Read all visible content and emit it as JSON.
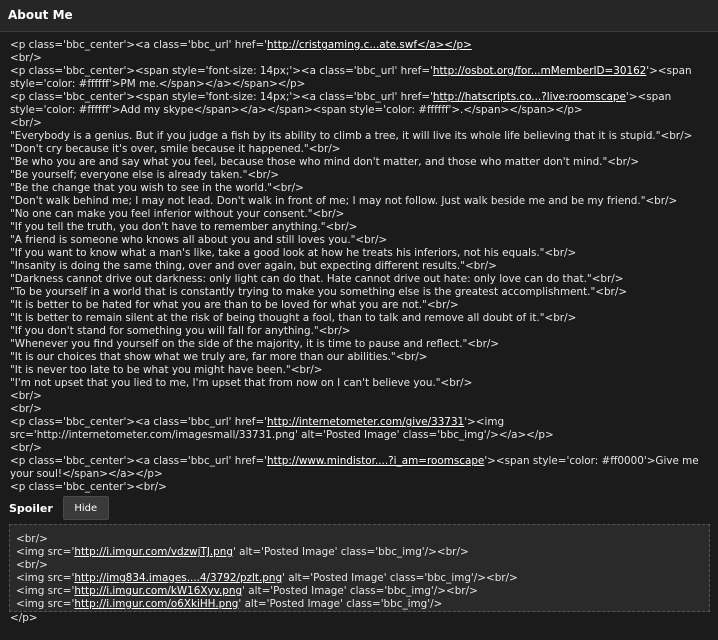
{
  "header": {
    "title": "About Me"
  },
  "lines": [
    [
      {
        "t": "<p class='bbc_center'><a class='bbc_url' href='"
      },
      {
        "t": "http://cristgaming.c...ate.swf</a></p>",
        "l": 1
      }
    ],
    [
      {
        "t": "<br/>"
      }
    ],
    [
      {
        "t": "<p class='bbc_center'><span style='font-size: 14px;'><a class='bbc_url' href='"
      },
      {
        "t": "http://osbot.org/for...mMemberID=30162",
        "l": 1
      },
      {
        "t": "'><span style='color: #ffffff'>PM me.</span></a></span></p>"
      }
    ],
    [
      {
        "t": "<p class='bbc_center'><span style='font-size: 14px;'><a class='bbc_url' href='"
      },
      {
        "t": "http://hatscripts.co...?live:roomscape",
        "l": 1
      },
      {
        "t": "'><span style='color: #ffffff'>Add my skype</span></a></span><span style='color: #ffffff'>.</span></span></p>"
      }
    ],
    [
      {
        "t": "<br/>"
      }
    ],
    [
      {
        "t": "\"Everybody is a genius. But if you judge a fish by its ability to climb a tree, it will live its whole life believing that it is stupid.\"<br/>"
      }
    ],
    [
      {
        "t": "\"Don't cry because it's over, smile because it happened.\"<br/>"
      }
    ],
    [
      {
        "t": "\"Be who you are and say what you feel, because those who mind don't matter, and those who matter don't mind.\"<br/>"
      }
    ],
    [
      {
        "t": "\"Be yourself; everyone else is already taken.\"<br/>"
      }
    ],
    [
      {
        "t": "\"Be the change that you wish to see in the world.\"<br/>"
      }
    ],
    [
      {
        "t": "\"Don't walk behind me; I may not lead. Don't walk in front of me; I may not follow. Just walk beside me and be my friend.\"<br/>"
      }
    ],
    [
      {
        "t": "\"No one can make you feel inferior without your consent.\"<br/>"
      }
    ],
    [
      {
        "t": "\"If you tell the truth, you don't have to remember anything.\"<br/>"
      }
    ],
    [
      {
        "t": "\"A friend is someone who knows all about you and still loves you.\"<br/>"
      }
    ],
    [
      {
        "t": "\"If you want to know what a man's like, take a good look at how he treats his inferiors, not his equals.\"<br/>"
      }
    ],
    [
      {
        "t": "\"Insanity is doing the same thing, over and over again, but expecting different results.\"<br/>"
      }
    ],
    [
      {
        "t": "\"Darkness cannot drive out darkness: only light can do that. Hate cannot drive out hate: only love can do that.\"<br/>"
      }
    ],
    [
      {
        "t": "\"To be yourself in a world that is constantly trying to make you something else is the greatest accomplishment.\"<br/>"
      }
    ],
    [
      {
        "t": "\"It is better to be hated for what you are than to be loved for what you are not.\"<br/>"
      }
    ],
    [
      {
        "t": "\"It is better to remain silent at the risk of being thought a fool, than to talk and remove all doubt of it.\"<br/>"
      }
    ],
    [
      {
        "t": "\"If you don't stand for something you will fall for anything.\"<br/>"
      }
    ],
    [
      {
        "t": "\"Whenever you find yourself on the side of the majority, it is time to pause and reflect.\"<br/>"
      }
    ],
    [
      {
        "t": "\"It is our choices that show what we truly are, far more than our abilities.\"<br/>"
      }
    ],
    [
      {
        "t": "\"It is never too late to be what you might have been.\"<br/>"
      }
    ],
    [
      {
        "t": "\"I'm not upset that you lied to me, I'm upset that from now on I can't believe you.\"<br/>"
      }
    ],
    [
      {
        "t": "<br/>"
      }
    ],
    [
      {
        "t": "<br/>"
      }
    ],
    [
      {
        "t": "<p class='bbc_center'><a class='bbc_url' href='"
      },
      {
        "t": "http://internetometer.com/give/33731",
        "l": 1
      },
      {
        "t": "'><img src='http://internetometer.com/imagesmall/33731.png' alt='Posted Image' class='bbc_img'/></a></p>"
      }
    ],
    [
      {
        "t": "<br/>"
      }
    ],
    [
      {
        "t": "<p class='bbc_center'><a class='bbc_url' href='"
      },
      {
        "t": "http://www.mindistor....?i_am=roomscape",
        "l": 1
      },
      {
        "t": "'><span style='color: #ff0000'>Give me your soul!</span></a></p>"
      }
    ],
    [
      {
        "t": "<p class='bbc_center'><br/>"
      }
    ]
  ],
  "spoiler": {
    "label": "Spoiler",
    "button": "Hide",
    "lines": [
      [
        {
          "t": "<br/>"
        }
      ],
      [
        {
          "t": "<img src='"
        },
        {
          "t": "http://i.imgur.com/vdzwjTJ.png",
          "l": 1
        },
        {
          "t": "' alt='Posted Image' class='bbc_img'/><br/>"
        }
      ],
      [
        {
          "t": "<br/>"
        }
      ],
      [
        {
          "t": "<img src='"
        },
        {
          "t": "http://img834.images....4/3792/pzlt.png",
          "l": 1
        },
        {
          "t": "' alt='Posted Image' class='bbc_img'/><br/>"
        }
      ],
      [
        {
          "t": "<img src='"
        },
        {
          "t": "http://i.imgur.com/kW16Xyv.png",
          "l": 1
        },
        {
          "t": "' alt='Posted Image' class='bbc_img'/><br/>"
        }
      ],
      [
        {
          "t": "<img src='"
        },
        {
          "t": "http://i.imgur.com/o6XkiHH.png",
          "l": 1
        },
        {
          "t": "' alt='Posted Image' class='bbc_img'/>"
        }
      ]
    ]
  },
  "footer_line": [
    {
      "t": "</p>"
    }
  ]
}
